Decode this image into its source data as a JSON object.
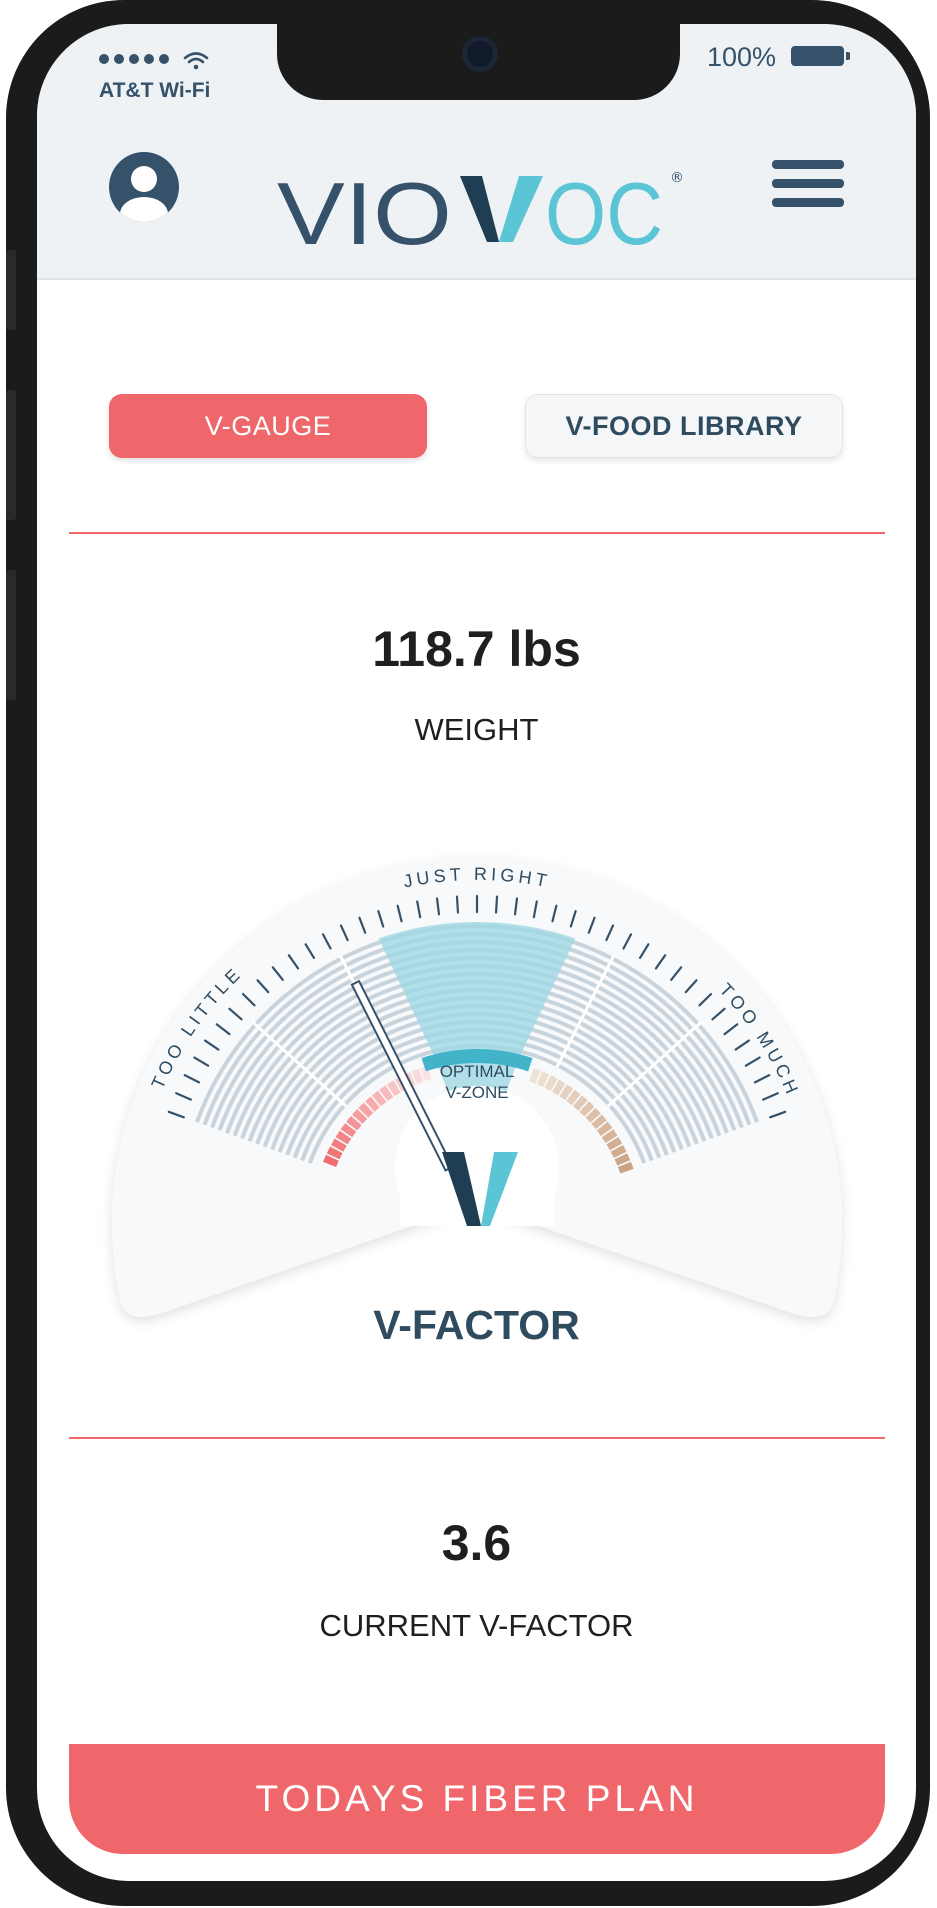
{
  "status_bar": {
    "carrier": "AT&T Wi-Fi",
    "battery": "100%"
  },
  "header": {
    "brand": "VIOVOC",
    "registered_mark": "®"
  },
  "tabs": [
    {
      "label": "V-GAUGE",
      "active": true
    },
    {
      "label": "V-FOOD LIBRARY",
      "active": false
    }
  ],
  "weight": {
    "value": "118.7 lbs",
    "label": "WEIGHT"
  },
  "gauge": {
    "title": "V-FACTOR",
    "left_label": "TOO LITTLE",
    "top_label": "JUST RIGHT",
    "right_label": "TOO MUCH",
    "zone_line1": "OPTIMAL",
    "zone_line2": "V-ZONE",
    "center_letter": "V",
    "needle_fraction": 0.36
  },
  "current": {
    "value": "3.6",
    "label": "CURRENT V-FACTOR"
  },
  "cta": {
    "label": "TODAYS FIBER PLAN"
  },
  "colors": {
    "accent": "#f0676b",
    "navy": "#2f4b60",
    "teal": "#5bc5d6",
    "tan": "#c9a080"
  }
}
